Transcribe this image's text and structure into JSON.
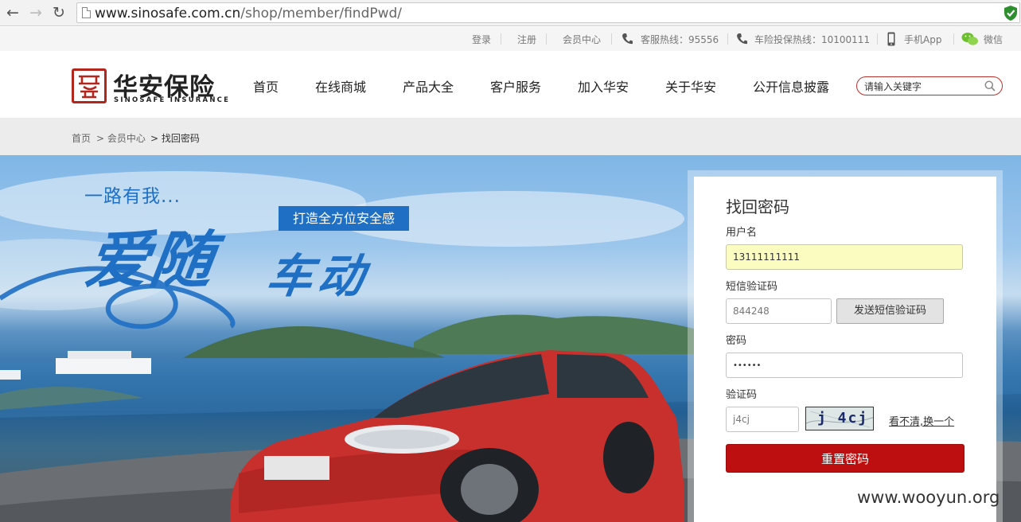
{
  "browser": {
    "url_host": "www.sinosafe.com.cn",
    "url_path": "/shop/member/findPwd/"
  },
  "topbar": {
    "login": "登录",
    "register": "注册",
    "member_center": "会员中心",
    "service_hotline": "客服热线：95556",
    "auto_hotline": "车险投保热线：10100111",
    "mobile_app": "手机App",
    "wechat": "微信"
  },
  "header": {
    "logo_cn": "华安保险",
    "logo_en": "SINOSAFE INSURANCE",
    "nav": [
      "首页",
      "在线商城",
      "产品大全",
      "客户服务",
      "加入华安",
      "关于华安",
      "公开信息披露"
    ],
    "search_placeholder": "请输入关键字"
  },
  "breadcrumb": {
    "home": "首页",
    "member": "> 会员中心",
    "current": "> 找回密码"
  },
  "hero": {
    "slogan_small": "一路有我...",
    "badge": "打造全方位安全感",
    "slogan_main": "爱随",
    "slogan_sub": "车动",
    "watermark": "www.wooyun.org"
  },
  "form": {
    "title": "找回密码",
    "username_label": "用户名",
    "username_value": "13111111111",
    "sms_label": "短信验证码",
    "sms_value": "844248",
    "sms_button": "发送短信验证码",
    "password_label": "密码",
    "password_value": "••••••",
    "captcha_label": "验证码",
    "captcha_value": "j4cj",
    "captcha_image_text": "j 4cj",
    "refresh_link": "看不清,换一个",
    "submit": "重置密码"
  },
  "colors": {
    "brand_red": "#bd0f0f",
    "slogan_blue": "#1f6fc4",
    "autofill_yellow": "#fafcc0"
  },
  "icons": [
    "back-arrow-icon",
    "forward-arrow-icon",
    "reload-icon",
    "page-icon",
    "security-shield-icon",
    "phone-icon",
    "mobile-icon",
    "wechat-icon",
    "search-icon"
  ]
}
